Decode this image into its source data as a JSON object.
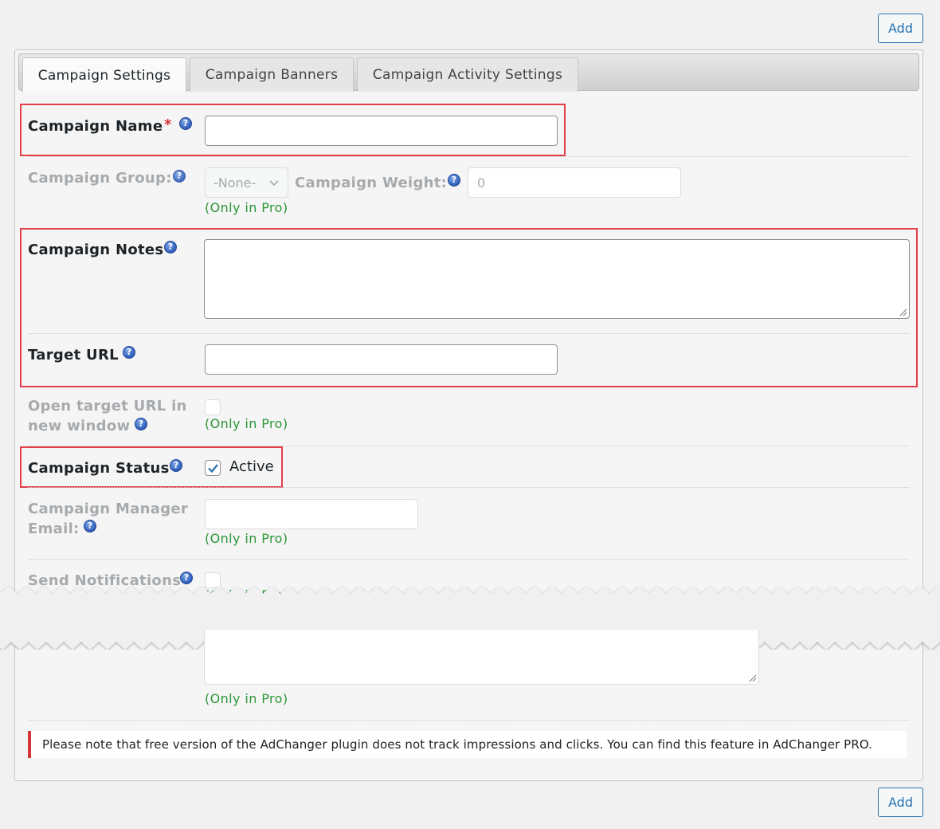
{
  "buttons": {
    "add_top": "Add",
    "add_bottom": "Add"
  },
  "tabs": [
    {
      "label": "Campaign Settings",
      "active": true
    },
    {
      "label": "Campaign Banners",
      "active": false
    },
    {
      "label": "Campaign Activity Settings",
      "active": false
    }
  ],
  "form": {
    "campaign_name": {
      "label": "Campaign Name",
      "required": "*",
      "value": ""
    },
    "campaign_group": {
      "label": "Campaign Group:",
      "selected": "-None-",
      "pro_note": "(Only in Pro)"
    },
    "campaign_weight": {
      "label": "Campaign Weight:",
      "value": "0"
    },
    "campaign_notes": {
      "label": "Campaign Notes",
      "value": ""
    },
    "target_url": {
      "label": "Target URL",
      "value": ""
    },
    "open_new_window": {
      "label_line1": "Open target URL in",
      "label_line2": "new window",
      "checked": false,
      "pro_note": "(Only in Pro)"
    },
    "campaign_status": {
      "label": "Campaign Status",
      "checkbox_label": "Active",
      "checked": true
    },
    "manager_email": {
      "label_line1": "Campaign Manager",
      "label_line2": "Email:",
      "value": "",
      "pro_note": "(Only in Pro)"
    },
    "send_notifications": {
      "label": "Send Notifications",
      "checked": false,
      "pro_note": "(Only in Pro)"
    },
    "bottom_textarea": {
      "value": "",
      "pro_note": "(Only in Pro)"
    }
  },
  "notice": "Please note that free version of the AdChanger plugin does not track impressions and clicks. You can find this feature in AdChanger PRO.",
  "help_glyph": "?",
  "colors": {
    "highlight": "#e23f4b",
    "pro_text": "#2d9637",
    "link": "#2271b1",
    "notice_bar": "#d63638"
  }
}
